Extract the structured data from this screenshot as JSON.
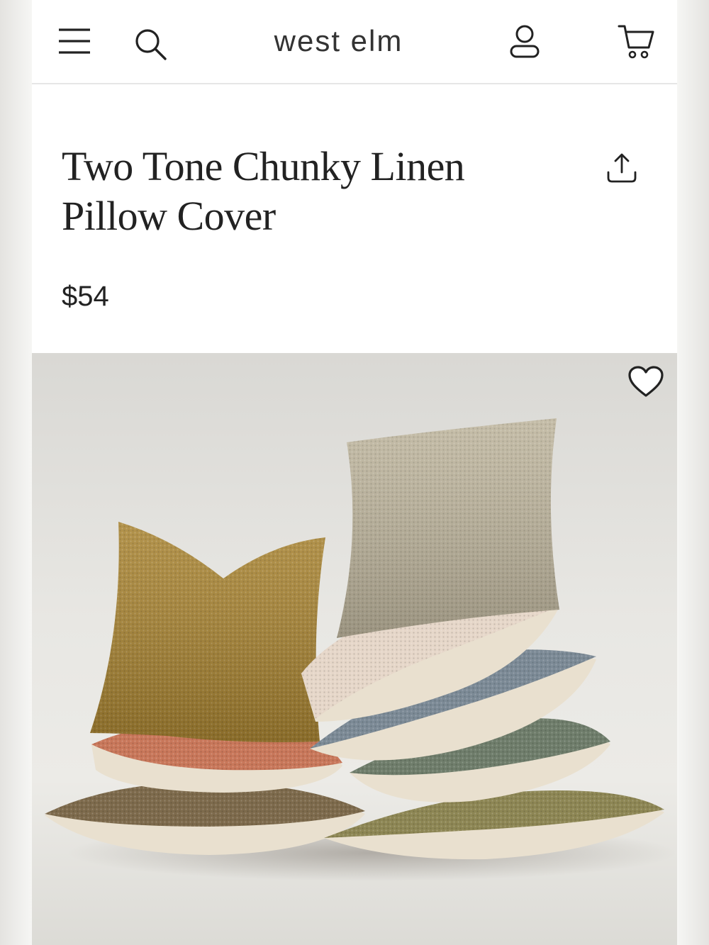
{
  "header": {
    "brand": "west elm",
    "menu_icon": "hamburger-menu-icon",
    "search_icon": "search-icon",
    "account_icon": "user-account-icon",
    "cart_icon": "shopping-cart-icon"
  },
  "product": {
    "title_line1": "Two Tone Chunky Linen",
    "title_line2": "Pillow Cover",
    "price": "$54",
    "share_icon": "share-icon",
    "favorite_icon": "heart-icon"
  },
  "colors": {
    "background": "#ffffff",
    "text": "#222222",
    "divider": "#e6e6e6",
    "pillows": {
      "mustard": "#a88433",
      "terracotta": "#c8775a",
      "walnut": "#7d6a4c",
      "oatmeal": "#bdb49c",
      "blush": "#e6d7c9",
      "slate-blue": "#7c8a96",
      "sage": "#6f7d6b",
      "olive": "#8d8654",
      "backing": "#e9e0cf"
    }
  }
}
